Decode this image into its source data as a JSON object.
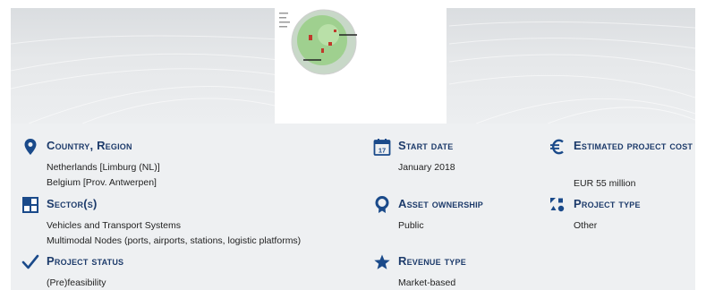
{
  "banner": {
    "thumbnail_icon": "map-thumbnail"
  },
  "fields": {
    "country_region": {
      "label": "Country, Region",
      "icon": "location-pin-icon",
      "values": [
        "Netherlands [Limburg (NL)]",
        "Belgium [Prov. Antwerpen]"
      ]
    },
    "sectors": {
      "label": "Sector(s)",
      "icon": "grid-squares-icon",
      "values": [
        "Vehicles and Transport Systems",
        "Multimodal Nodes (ports, airports, stations, logistic platforms)"
      ]
    },
    "project_status": {
      "label": "Project status",
      "icon": "checkmark-icon",
      "values": [
        "(Pre)feasibility"
      ]
    },
    "start_date": {
      "label": "Start date",
      "icon": "calendar-icon",
      "calendar_day": "17",
      "values": [
        "January 2018"
      ]
    },
    "asset_ownership": {
      "label": "Asset ownership",
      "icon": "award-ribbon-icon",
      "values": [
        "Public"
      ]
    },
    "revenue_type": {
      "label": "Revenue type",
      "icon": "star-icon",
      "values": [
        "Market-based"
      ]
    },
    "estimated_cost": {
      "label": "Estimated project cost",
      "icon": "euro-icon",
      "values": [
        "EUR 55 million"
      ]
    },
    "project_type": {
      "label": "Project type",
      "icon": "shapes-icon",
      "values": [
        "Other"
      ]
    }
  },
  "colors": {
    "accent": "#1d3b6b",
    "icon": "#1a4a8a",
    "card_bg": "#eef0f2"
  }
}
